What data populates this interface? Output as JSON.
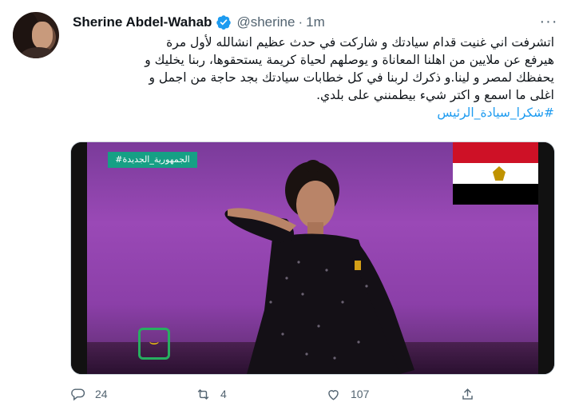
{
  "tweet": {
    "author_name": "Sherine Abdel-Wahab",
    "handle": "@sherine",
    "separator": "·",
    "time": "1m",
    "more_label": "···",
    "lines": [
      "اتشرفت اني غنيت قدام سيادتك و شاركت في حدث عظيم انشالله لأول مرة",
      "هيرفع عن ملايين من اهلنا المعاناة و يوصلهم لحياة كريمة يستحقوها، ربنا يخليك و",
      "يحفظك لمصر و لينا.و ذكرك لربنا في كل خطابات سيادتك بجد حاجة من اجمل و",
      "اغلى ما اسمع و اكتر شيء بيطمنني على بلدي."
    ],
    "hashtag": "#شكرا_سيادة_الرئيس"
  },
  "media": {
    "channel_tag": "#الجمهورية_الجديدة",
    "corner_logo": "⌣"
  },
  "actions": {
    "reply_count": "24",
    "retweet_count": "4",
    "like_count": "107"
  },
  "icons": {
    "verified": "verified-badge-icon",
    "reply": "reply-icon",
    "retweet": "retweet-icon",
    "like": "heart-icon",
    "share": "share-icon"
  },
  "colors": {
    "accent": "#1d9bf0",
    "muted": "#536471",
    "text": "#0f1419"
  }
}
